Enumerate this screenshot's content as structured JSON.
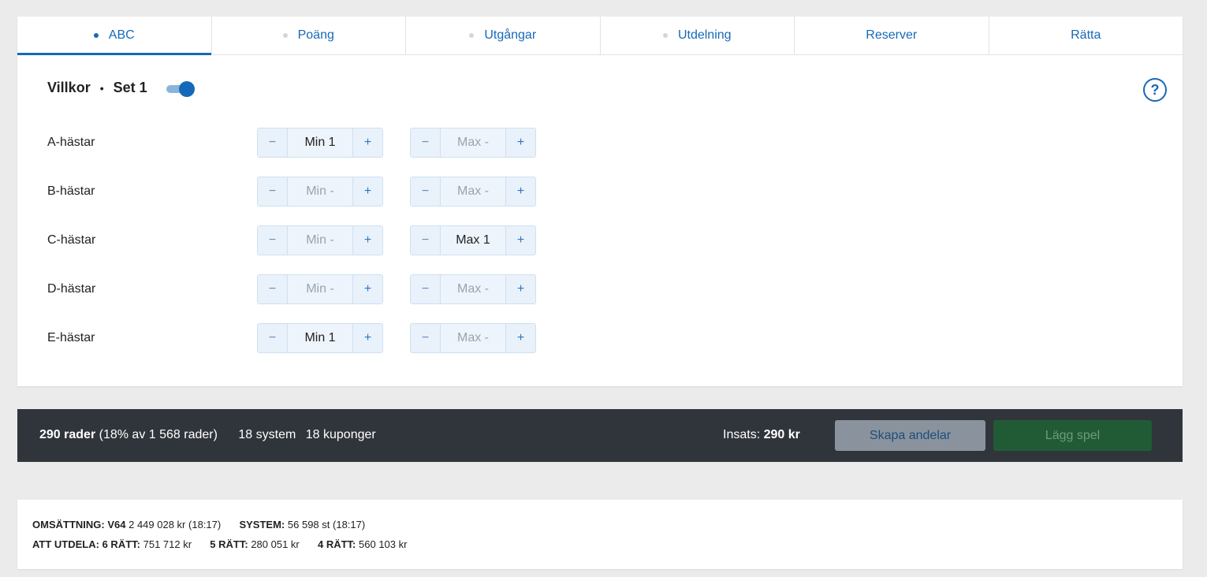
{
  "tabs": [
    {
      "label": "ABC",
      "dot": true,
      "active": true
    },
    {
      "label": "Poäng",
      "dot": true
    },
    {
      "label": "Utgångar",
      "dot": true
    },
    {
      "label": "Utdelning",
      "dot": true
    },
    {
      "label": "Reserver",
      "dot": false
    },
    {
      "label": "Rätta",
      "dot": false
    }
  ],
  "header": {
    "title": "Villkor",
    "separator": "•",
    "set": "Set 1",
    "toggle_on": true,
    "help_glyph": "?"
  },
  "rows": [
    {
      "label": "A-hästar",
      "min": "Min 1",
      "min_set": true,
      "max": "Max -",
      "max_set": false
    },
    {
      "label": "B-hästar",
      "min": "Min -",
      "min_set": false,
      "max": "Max -",
      "max_set": false
    },
    {
      "label": "C-hästar",
      "min": "Min -",
      "min_set": false,
      "max": "Max 1",
      "max_set": true
    },
    {
      "label": "D-hästar",
      "min": "Min -",
      "min_set": false,
      "max": "Max -",
      "max_set": false
    },
    {
      "label": "E-hästar",
      "min": "Min 1",
      "min_set": true,
      "max": "Max -",
      "max_set": false
    }
  ],
  "stepper": {
    "minus": "−",
    "plus": "+"
  },
  "summary": {
    "rows_bold": "290 rader",
    "rows_detail": "(18% av 1 568 rader)",
    "system": "18 system",
    "kuponger": "18 kuponger",
    "insats_label": "Insats:",
    "insats_value": "290 kr",
    "share_button": "Skapa andelar",
    "place_button": "Lägg spel"
  },
  "info": {
    "omsattning_label": "OMSÄTTNING:",
    "omsattning_game": "V64",
    "omsattning_value": "2 449 028 kr",
    "omsattning_time": "(18:17)",
    "system_label": "SYSTEM:",
    "system_value": "56 598 st",
    "system_time": "(18:17)",
    "utdela_label": "ATT UTDELA:",
    "r6_label": "6 RÄTT:",
    "r6_value": "751 712 kr",
    "r5_label": "5 RÄTT:",
    "r5_value": "280 051 kr",
    "r4_label": "4 RÄTT:",
    "r4_value": "560 103 kr"
  },
  "colors": {
    "accent": "#1669b8",
    "bar_bg": "#30353b",
    "share_button_bg": "#8a939d",
    "place_button_bg": "#215b36"
  }
}
